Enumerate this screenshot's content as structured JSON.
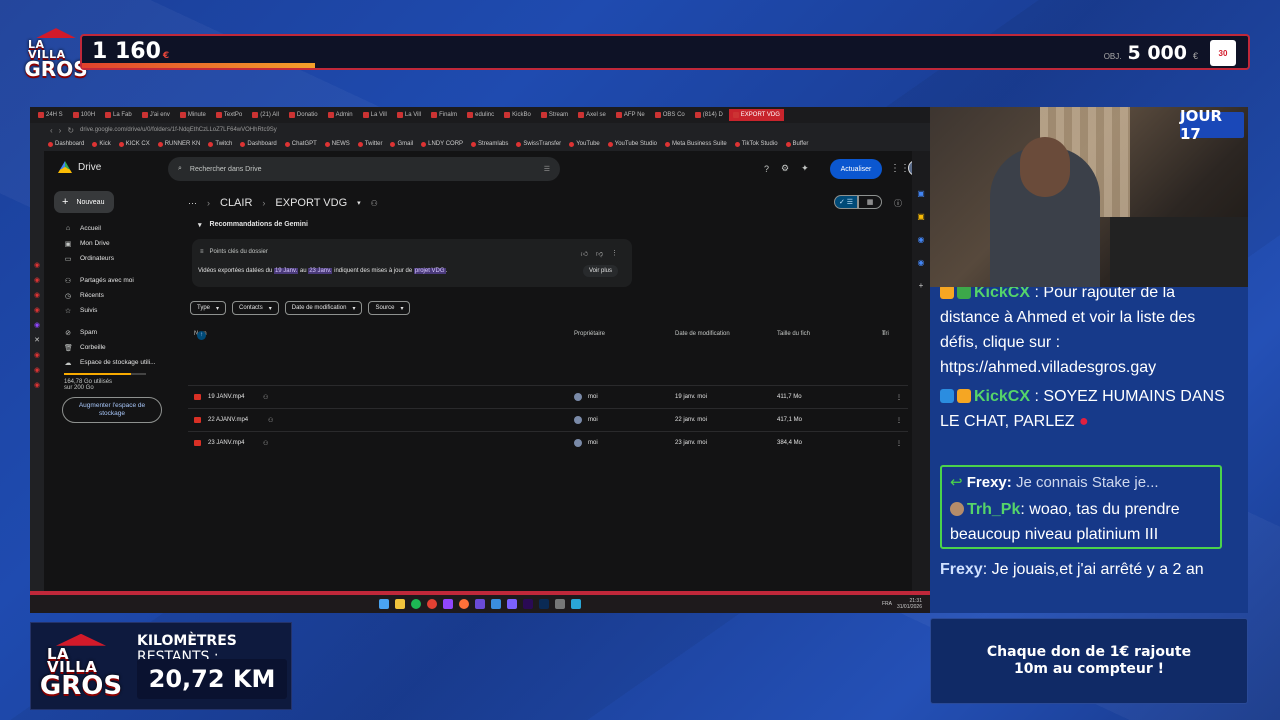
{
  "overlay": {
    "logo_line1": "LA VILLA",
    "logo_line2": "GROS",
    "counter": "1 160",
    "counter_currency": "€",
    "progress_fraction": 0.2,
    "goal_prefix": "OBJ.",
    "goal_value": "5 000",
    "goal_currency": "€",
    "badge": "30",
    "jour": "JOUR 17",
    "km_label_bold": "KILOMÈTRES",
    "km_label_rest": "RESTANTS :",
    "km_value": "20,72 KM",
    "don_line1": "Chaque don de 1€ rajoute",
    "don_line2": "10m au compteur !"
  },
  "browser": {
    "tabs": [
      {
        "label": "24H S"
      },
      {
        "label": "100H"
      },
      {
        "label": "La Fab"
      },
      {
        "label": "J'ai env"
      },
      {
        "label": "Minute"
      },
      {
        "label": "TextPo"
      },
      {
        "label": "(21) All"
      },
      {
        "label": "Donatio"
      },
      {
        "label": "Admin"
      },
      {
        "label": "La Vill"
      },
      {
        "label": "La Vill"
      },
      {
        "label": "Finalm"
      },
      {
        "label": "edulinc"
      },
      {
        "label": "KickBo"
      },
      {
        "label": "Stream"
      },
      {
        "label": "Axel se"
      },
      {
        "label": "AFP Ne"
      },
      {
        "label": "OBS Co"
      },
      {
        "label": "(814) D"
      },
      {
        "label": "EXPORT VDG"
      }
    ],
    "url": "drive.google.com/drive/u/0/folders/1f-NdqEthCzLLoZ7LF64wVOHhRtc9Sy",
    "bookmarks": [
      "Dashboard",
      "Kick",
      "KICK CX",
      "RUNNER KN",
      "Twitch",
      "Dashboard",
      "ChatGPT",
      "NEWS",
      "Twitter",
      "Gmail",
      "LNDY CORP",
      "Streamlabs",
      "SwissTransfer",
      "YouTube",
      "YouTube Studio",
      "Meta Business Suite",
      "TikTok Studio",
      "Buffer"
    ]
  },
  "drive": {
    "app_name": "Drive",
    "search_placeholder": "Rechercher dans Drive",
    "update_button": "Actualiser",
    "new_button": "Nouveau",
    "nav": [
      {
        "label": "Accueil",
        "icon": "home-icon"
      },
      {
        "label": "Mon Drive",
        "icon": "drive-icon"
      },
      {
        "label": "Ordinateurs",
        "icon": "computer-icon"
      },
      {
        "label": "Partagés avec moi",
        "icon": "shared-icon"
      },
      {
        "label": "Récents",
        "icon": "clock-icon"
      },
      {
        "label": "Suivis",
        "icon": "star-icon"
      },
      {
        "label": "Spam",
        "icon": "spam-icon"
      },
      {
        "label": "Corbeille",
        "icon": "trash-icon"
      },
      {
        "label": "Espace de stockage utili...",
        "icon": "cloud-icon"
      }
    ],
    "storage_used": "164,78 Go utilisés",
    "storage_total": "sur 200 Go",
    "storage_fraction": 0.82,
    "upgrade_button": "Augmenter l'espace de stockage",
    "breadcrumb": {
      "dots": "···",
      "parent": "CLAIR",
      "current": "EXPORT VDG"
    },
    "gemini": {
      "header": "Recommandations de Gemini",
      "title": "Points clés du dossier",
      "text_1": "Vidéos exportées datées du ",
      "hl_1": "19 Janv.",
      "text_2": " au ",
      "hl_2": "23 Janv.",
      "text_3": " indiquent des mises à jour de ",
      "hl_3": "projet VDG",
      "text_4": ".",
      "more": "Voir plus"
    },
    "filters": [
      "Type",
      "Contacts",
      "Date de modification",
      "Source"
    ],
    "columns": {
      "name": "Nom",
      "owner": "Propriétaire",
      "modified": "Date de modification",
      "size": "Taille du fich",
      "sort": "Tri"
    },
    "files": [
      {
        "name": "19 JANV.mp4",
        "owner": "moi",
        "modified": "19 janv. moi",
        "size": "411,7 Mo"
      },
      {
        "name": "22 AJANV.mp4",
        "owner": "moi",
        "modified": "22 janv. moi",
        "size": "417,1 Mo"
      },
      {
        "name": "23 JANV.mp4",
        "owner": "moi",
        "modified": "23 janv. moi",
        "size": "384,4 Mo"
      }
    ]
  },
  "taskbar": {
    "lang": "FRA",
    "time": "21:31",
    "date": "31/01/2026"
  },
  "chat": [
    {
      "user": "KickCX",
      "sep": ":",
      "text": "Pour rajouter de la distance à Ahmed et voir la liste des défis, clique sur : https://ahmed.villadesgros.gay"
    },
    {
      "user": "KickCX",
      "sep": ":",
      "text": "SOYEZ HUMAINS DANS LE CHAT, PARLEZ"
    }
  ],
  "reply": {
    "to_user": "Frexy:",
    "to_text": "Je connais Stake je...",
    "user": "Trh_Pk",
    "sep": ":",
    "text": "woao, tas du prendre beaucoup niveau platinium III"
  },
  "last_msg": {
    "user": "Frexy",
    "sep": ":",
    "text": "Je jouais,et j'ai arrêté y a 2 an"
  }
}
